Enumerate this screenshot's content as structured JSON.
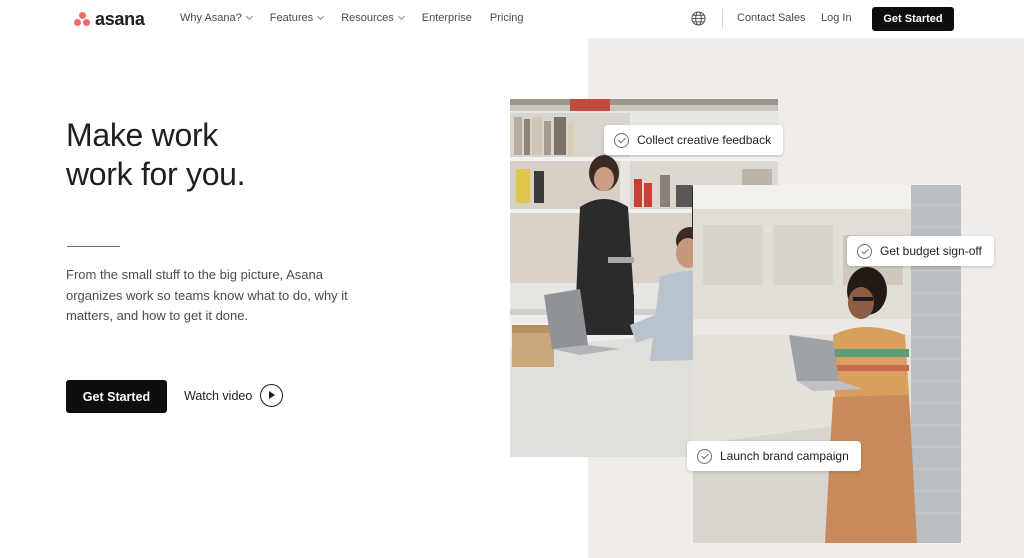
{
  "header": {
    "logo_text": "asana",
    "nav": [
      {
        "label": "Why Asana?",
        "has_dropdown": true
      },
      {
        "label": "Features",
        "has_dropdown": true
      },
      {
        "label": "Resources",
        "has_dropdown": true
      },
      {
        "label": "Enterprise",
        "has_dropdown": false
      },
      {
        "label": "Pricing",
        "has_dropdown": false
      }
    ],
    "language_icon": "globe-icon",
    "contact_sales": "Contact Sales",
    "log_in": "Log In",
    "get_started": "Get Started"
  },
  "hero": {
    "headline_line1": "Make work",
    "headline_line2": "work for you.",
    "description": "From the small stuff to the big picture, Asana organizes work so teams know what to do, why it matters, and how to get it done.",
    "cta_label": "Get Started",
    "watch_video_label": "Watch video"
  },
  "visual": {
    "tags": [
      {
        "label": "Collect creative feedback"
      },
      {
        "label": "Get budget sign-off"
      },
      {
        "label": "Launch brand campaign"
      }
    ]
  },
  "colors": {
    "brand_coral": "#f06a6a",
    "button_black": "#0d0e10",
    "panel_beige": "#f0ecea"
  }
}
